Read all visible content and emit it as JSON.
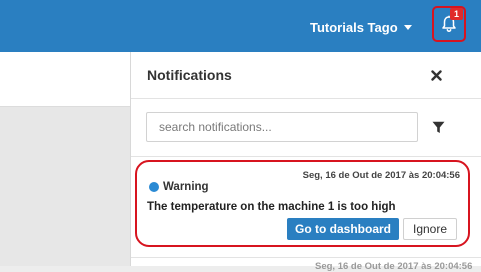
{
  "colors": {
    "header": "#2a7fc1",
    "highlight": "#d7141f",
    "badge": "#e02b2b",
    "warning_dot": "#2a8ad4"
  },
  "header": {
    "user_name": "Tutorials Tago",
    "bell_icon": "bell-icon",
    "notification_count": "1"
  },
  "panel": {
    "title": "Notifications",
    "close_icon": "close-icon",
    "search_placeholder": "search notifications...",
    "search_value": "",
    "filter_icon": "filter-icon"
  },
  "notifications": [
    {
      "timestamp": "Seg, 16 de Out de 2017 às 20:04:56",
      "level": "Warning",
      "message": "The temperature on the machine 1 is too high",
      "primary_action": "Go to dashboard",
      "secondary_action": "Ignore"
    },
    {
      "timestamp": "Seg, 16 de Out de 2017 às 20:04:56"
    }
  ]
}
